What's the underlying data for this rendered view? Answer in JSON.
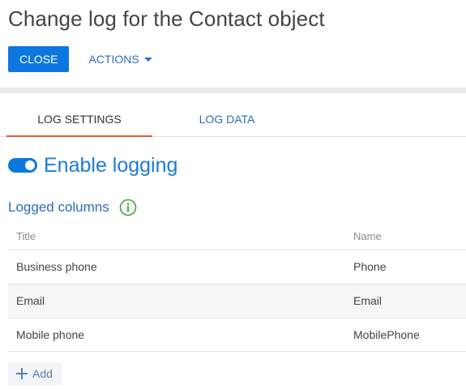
{
  "page": {
    "title": "Change log for the Contact object"
  },
  "toolbar": {
    "close_label": "CLOSE",
    "actions_label": "ACTIONS"
  },
  "tabs": [
    {
      "label": "LOG SETTINGS",
      "active": true
    },
    {
      "label": "LOG DATA",
      "active": false
    }
  ],
  "logging": {
    "label": "Enable logging",
    "enabled": true
  },
  "logged_columns": {
    "title": "Logged columns",
    "headers": {
      "title": "Title",
      "name": "Name"
    },
    "rows": [
      {
        "title": "Business phone",
        "name": "Phone"
      },
      {
        "title": "Email",
        "name": "Email"
      },
      {
        "title": "Mobile phone",
        "name": "MobilePhone"
      }
    ],
    "add_label": "Add"
  },
  "colors": {
    "primary": "#0d77e0",
    "link": "#2c6ebf",
    "tab_active_underline": "#e85a2e",
    "info_icon": "#3fa535"
  },
  "icons": {
    "actions_caret": "chevron-down-icon",
    "info": "info-icon",
    "add": "plus-icon"
  }
}
